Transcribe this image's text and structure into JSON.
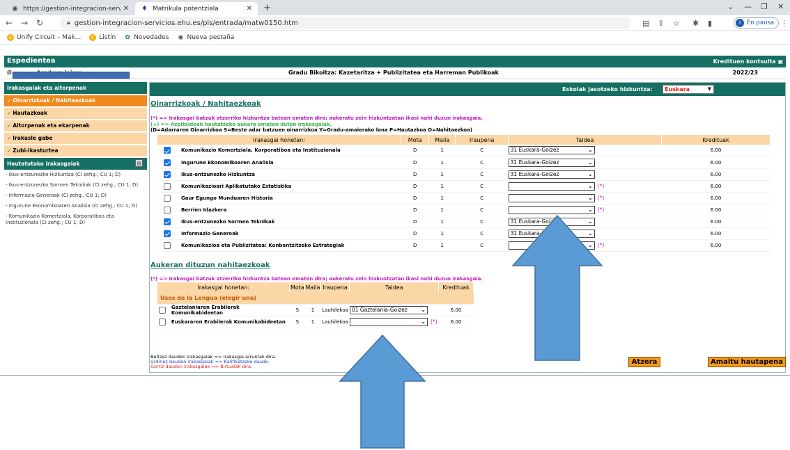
{
  "browser": {
    "tabs": [
      {
        "title": "https://gestion-integracion-servi",
        "active": false
      },
      {
        "title": "Matrikula potentziala",
        "active": true
      }
    ],
    "url": "gestion-integracion-servicios.ehu.es/pls/entrada/matw0150.htm",
    "profile_label": "En pausa",
    "profile_initial": "I",
    "bookmarks": [
      "Unify Circuit – Mak...",
      "Listín",
      "Novedades",
      "Nueva pestaña"
    ]
  },
  "header": {
    "title": "Espedientea",
    "credit_link": "Kredituen kontsulta",
    "student_name": "Ø... ... ... Aradoyo Jaime",
    "degree": "Gradu Bikoitza: Kazetaritza + Publizitatea eta Harreman Publikoak",
    "year": "2022/23"
  },
  "sidebar": {
    "section1": "Irakasgaiak eta aitorpenak",
    "items": [
      {
        "label": "Oinarrizkoak / Nahitaezkoak",
        "active": true
      },
      {
        "label": "Hautazkoak",
        "active": false
      },
      {
        "label": "Aitorpenak eta ekarpenak",
        "active": false
      },
      {
        "label": "Irakasle gabe",
        "active": false
      },
      {
        "label": "Zubi-ikasturtea",
        "active": false
      }
    ],
    "section2": "Hautatutako irakasgaiak",
    "selected": [
      "- Ikus-entzunezko Hizkuntza (CI zehg.; CU 1; D)",
      "- Ikus-entzunezko Sormen Teknikak (CI zehg.; CU 1; D)",
      "- Informazio Generoak (CI zehg.; CU 1; D)",
      "- Ingurune Ekonomikoaren Analisia (CI zehg.; CU 1; D)",
      "- Komunikazio Komertziala, Korporatiboa eta Instituzionala (CI zehg.; CU 1; D)"
    ]
  },
  "content": {
    "lang_label": "Eskolak jasotzeko hizkuntza:",
    "lang_value": "Euskara",
    "section1_title": "Oinarrizkoak / Nahitaezkoak",
    "note_star": "(*) => Irakasgai batzuk atzerriko hizkuntza batean ematen dira; aukeratu zein hizkuntzatan ikasi nahi duzun irakasgaia.",
    "note_plus": "(+) => Azpitaldeak hautatzeko aukera ematen duten irakasgaiak.",
    "note_types": "(D=Adarraren Oinarrizkoa S=Beste adar batzuen oinarrizkoa Y=Gradu-amaierako lana P=Hautazkoa O=Nahitaezkoa)",
    "columns": [
      "Irakasgai honetan:",
      "Mota",
      "Maila",
      "Iraupena",
      "Taldea",
      "Kredituak"
    ],
    "rows": [
      {
        "checked": true,
        "name": "Komunikazio Komertziala, Korporatiboa eta Instituzionala",
        "mota": "D",
        "maila": "1",
        "iraupena": "C",
        "taldea": "31 Euskara-Goizez",
        "star": "",
        "kredituak": "6.00"
      },
      {
        "checked": true,
        "name": "Ingurune Ekonomikoaren Analisia",
        "mota": "D",
        "maila": "1",
        "iraupena": "C",
        "taldea": "31 Euskara-Goizez",
        "star": "",
        "kredituak": "6.00"
      },
      {
        "checked": true,
        "name": "Ikus-entzunezko Hizkuntza",
        "mota": "D",
        "maila": "1",
        "iraupena": "C",
        "taldea": "31 Euskara-Goizez",
        "star": "",
        "kredituak": "6.00"
      },
      {
        "checked": false,
        "name": "Komunikazioari Aplikatutako Estatistika",
        "mota": "D",
        "maila": "1",
        "iraupena": "C",
        "taldea": "",
        "star": "(*)",
        "kredituak": "6.00"
      },
      {
        "checked": false,
        "name": "Gaur Egungo Munduaren Historia",
        "mota": "D",
        "maila": "1",
        "iraupena": "C",
        "taldea": "",
        "star": "(*)",
        "kredituak": "6.00"
      },
      {
        "checked": false,
        "name": "Berrien Idazkera",
        "mota": "D",
        "maila": "1",
        "iraupena": "C",
        "taldea": "",
        "star": "(*)",
        "kredituak": "6.00"
      },
      {
        "checked": true,
        "name": "Ikus-entzunezko Sormen Teknikak",
        "mota": "D",
        "maila": "1",
        "iraupena": "C",
        "taldea": "31 Euskara-Goizez",
        "star": "",
        "kredituak": "6.00"
      },
      {
        "checked": true,
        "name": "Informazio Generoak",
        "mota": "D",
        "maila": "1",
        "iraupena": "C",
        "taldea": "31 Euskara-Goizez",
        "star": "",
        "kredituak": "6.00"
      },
      {
        "checked": false,
        "name": "Komunikazioa eta Publizitatea: Konbentzitzeko Estrategiak",
        "mota": "D",
        "maila": "1",
        "iraupena": "C",
        "taldea": "",
        "star": "(*)",
        "kredituak": "6.00"
      }
    ],
    "section2_title": "Aukeran dituzun nahitaezkoak",
    "note2_star": "(*) => Irakasgai batzuk atzerriko hizkuntza batean ematen dira; aukeratu zein hizkuntzatan ikasi nahi duzun irakasgaia.",
    "columns2": [
      "Irakasgai honetan:",
      "Mota",
      "Maila",
      "Iraupena",
      "Taldea",
      "Kredituak"
    ],
    "group_label": "Usos de la Lengua (elegir una)",
    "rows2": [
      {
        "checked": false,
        "name": "Gaztelaniaren Erabilerak Komunikabideetan",
        "mota": "S",
        "maila": "1",
        "iraupena": "Lauhilekoa",
        "taldea": "01 Gaztelania-Goizez",
        "star": "",
        "kredituak": "6.00"
      },
      {
        "checked": false,
        "name": "Euskararen Erabilerak Komunikabideetan",
        "mota": "S",
        "maila": "1",
        "iraupena": "Lauhilekoa",
        "taldea": "",
        "star": "(*)",
        "kredituak": "6.00"
      }
    ],
    "legend": [
      "Beltzez dauden irakasgaiak => Irakasgai arruntak dira.",
      "Urdinez dauden irakasgaiak => Kalifikatzeke daude.",
      "Gorriz dauden irakasgaiak => Birtualak dira."
    ],
    "btn_back": "Atzera",
    "btn_finish": "Amaitu hautapena"
  },
  "colors": {
    "header_green": "#166f63",
    "menu_orange": "#f08a1d",
    "menu_peach": "#fbd6a6",
    "arrow_blue": "#5b9bd5"
  }
}
